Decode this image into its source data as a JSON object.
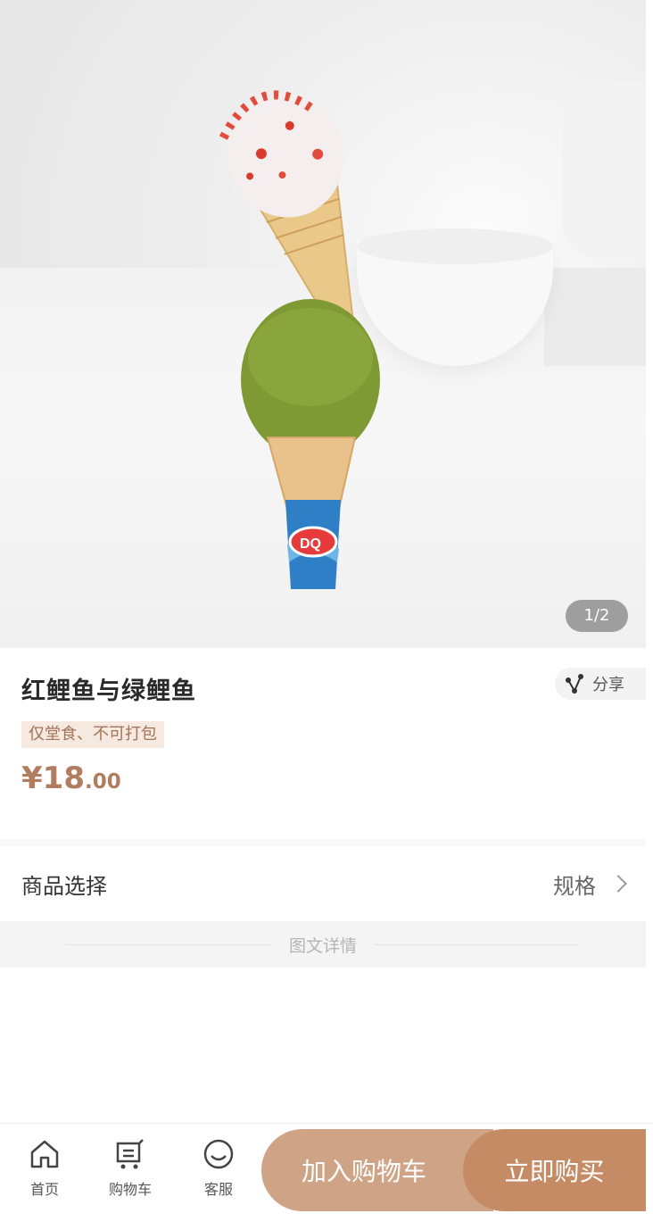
{
  "gallery": {
    "pager": "1/2"
  },
  "product": {
    "title": "红鲤鱼与绿鲤鱼",
    "share_label": "分享",
    "tag": "仅堂食、不可打包",
    "price_currency": "¥",
    "price_int": "18",
    "price_dec": ".00"
  },
  "options": {
    "label": "商品选择",
    "value": "规格"
  },
  "details": {
    "label": "图文详情"
  },
  "footer": {
    "home_label": "首页",
    "cart_label": "购物车",
    "service_label": "客服",
    "add_to_cart": "加入购物车",
    "buy_now": "立即购买"
  },
  "colors": {
    "accent_light": "#cfa486",
    "accent_dark": "#c58b65",
    "price": "#b07e5e",
    "tag_bg": "#f6e9df",
    "tag_text": "#a3735a"
  }
}
